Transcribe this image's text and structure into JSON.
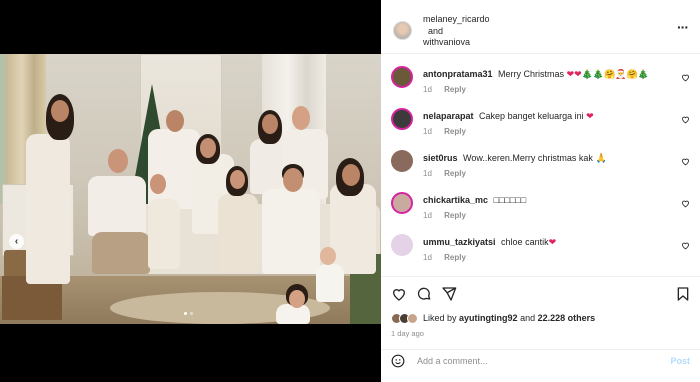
{
  "post": {
    "authors": [
      "melaney_ricardo",
      "withvaniova"
    ],
    "and_text": "and",
    "image_alt": "Family Christmas photo",
    "carousel": {
      "current": 1,
      "total": 2
    }
  },
  "comments": [
    {
      "username": "antonpratama31",
      "text": "Merry Christmas",
      "emoji": "❤❤🎄🎄🤗🎅🤗🎄",
      "age": "1d",
      "reply": "Reply",
      "avatar_color": "#6b5a3a",
      "ring": true
    },
    {
      "username": "nelaparapat",
      "text": "Cakep banget keluarga ini",
      "emoji": "❤",
      "age": "1d",
      "reply": "Reply",
      "avatar_color": "#3d3a3c",
      "ring": true
    },
    {
      "username": "siet0rus",
      "text": "Wow..keren.Merry christmas kak",
      "emoji": "🙏",
      "age": "1d",
      "reply": "Reply",
      "avatar_color": "#8a6a5c",
      "ring": false
    },
    {
      "username": "chickartika_mc",
      "text": "□□□□□□",
      "emoji": "",
      "age": "1d",
      "reply": "Reply",
      "avatar_color": "#c9a9a0",
      "ring": true
    },
    {
      "username": "ummu_tazkiyatsi",
      "text": "chloe cantik",
      "emoji": "❤",
      "age": "1d",
      "reply": "Reply",
      "avatar_color": "#e4d2e6",
      "ring": false
    }
  ],
  "likes": {
    "prefix": "Liked by",
    "user": "ayutingting92",
    "joiner": "and",
    "count": "22.228 others"
  },
  "time_ago": "1 day ago",
  "add_comment": {
    "placeholder": "Add a comment...",
    "post_label": "Post"
  },
  "icons": {
    "more": "more-horizontal-icon",
    "like": "heart-icon",
    "comment": "comment-bubble-icon",
    "share": "paper-plane-icon",
    "save": "bookmark-icon",
    "emoji": "smiley-icon",
    "prev": "chevron-left-icon"
  },
  "colors": {
    "accent": "#0095f6",
    "post_disabled": "#b3dbff",
    "meta": "#8e8e8e",
    "heart_emoji": "#e0245e"
  }
}
